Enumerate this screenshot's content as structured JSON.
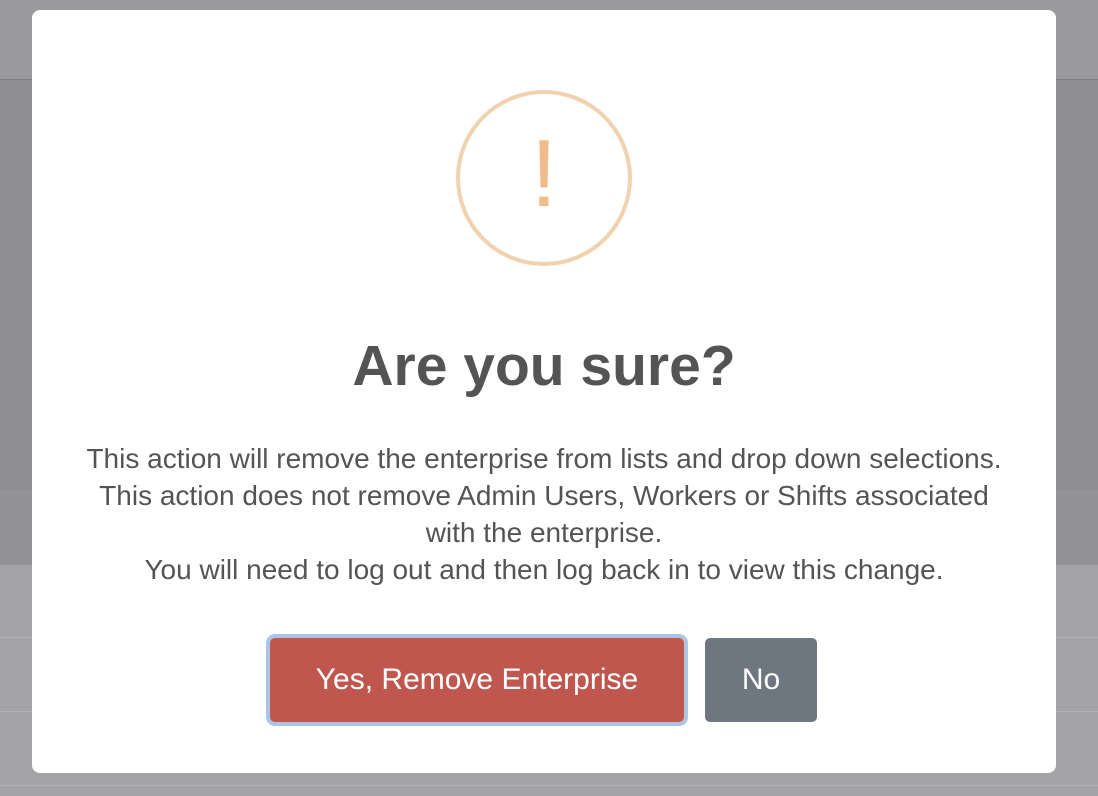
{
  "dialog": {
    "title": "Are you sure?",
    "icon": "warning-icon",
    "icon_glyph": "!",
    "message_lines": [
      "This action will remove the enterprise from lists and drop down selections. This action does not remove Admin Users, Workers or Shifts associated with the enterprise.",
      "You will need to log out and then log back in to view this change."
    ],
    "confirm_label": "Yes, Remove Enterprise",
    "cancel_label": "No"
  },
  "colors": {
    "overlay": "#9a9a9c",
    "warning": "#f0bc8a",
    "confirm_button": "#c0574f",
    "cancel_button": "#6e7780",
    "text": "#545454"
  }
}
